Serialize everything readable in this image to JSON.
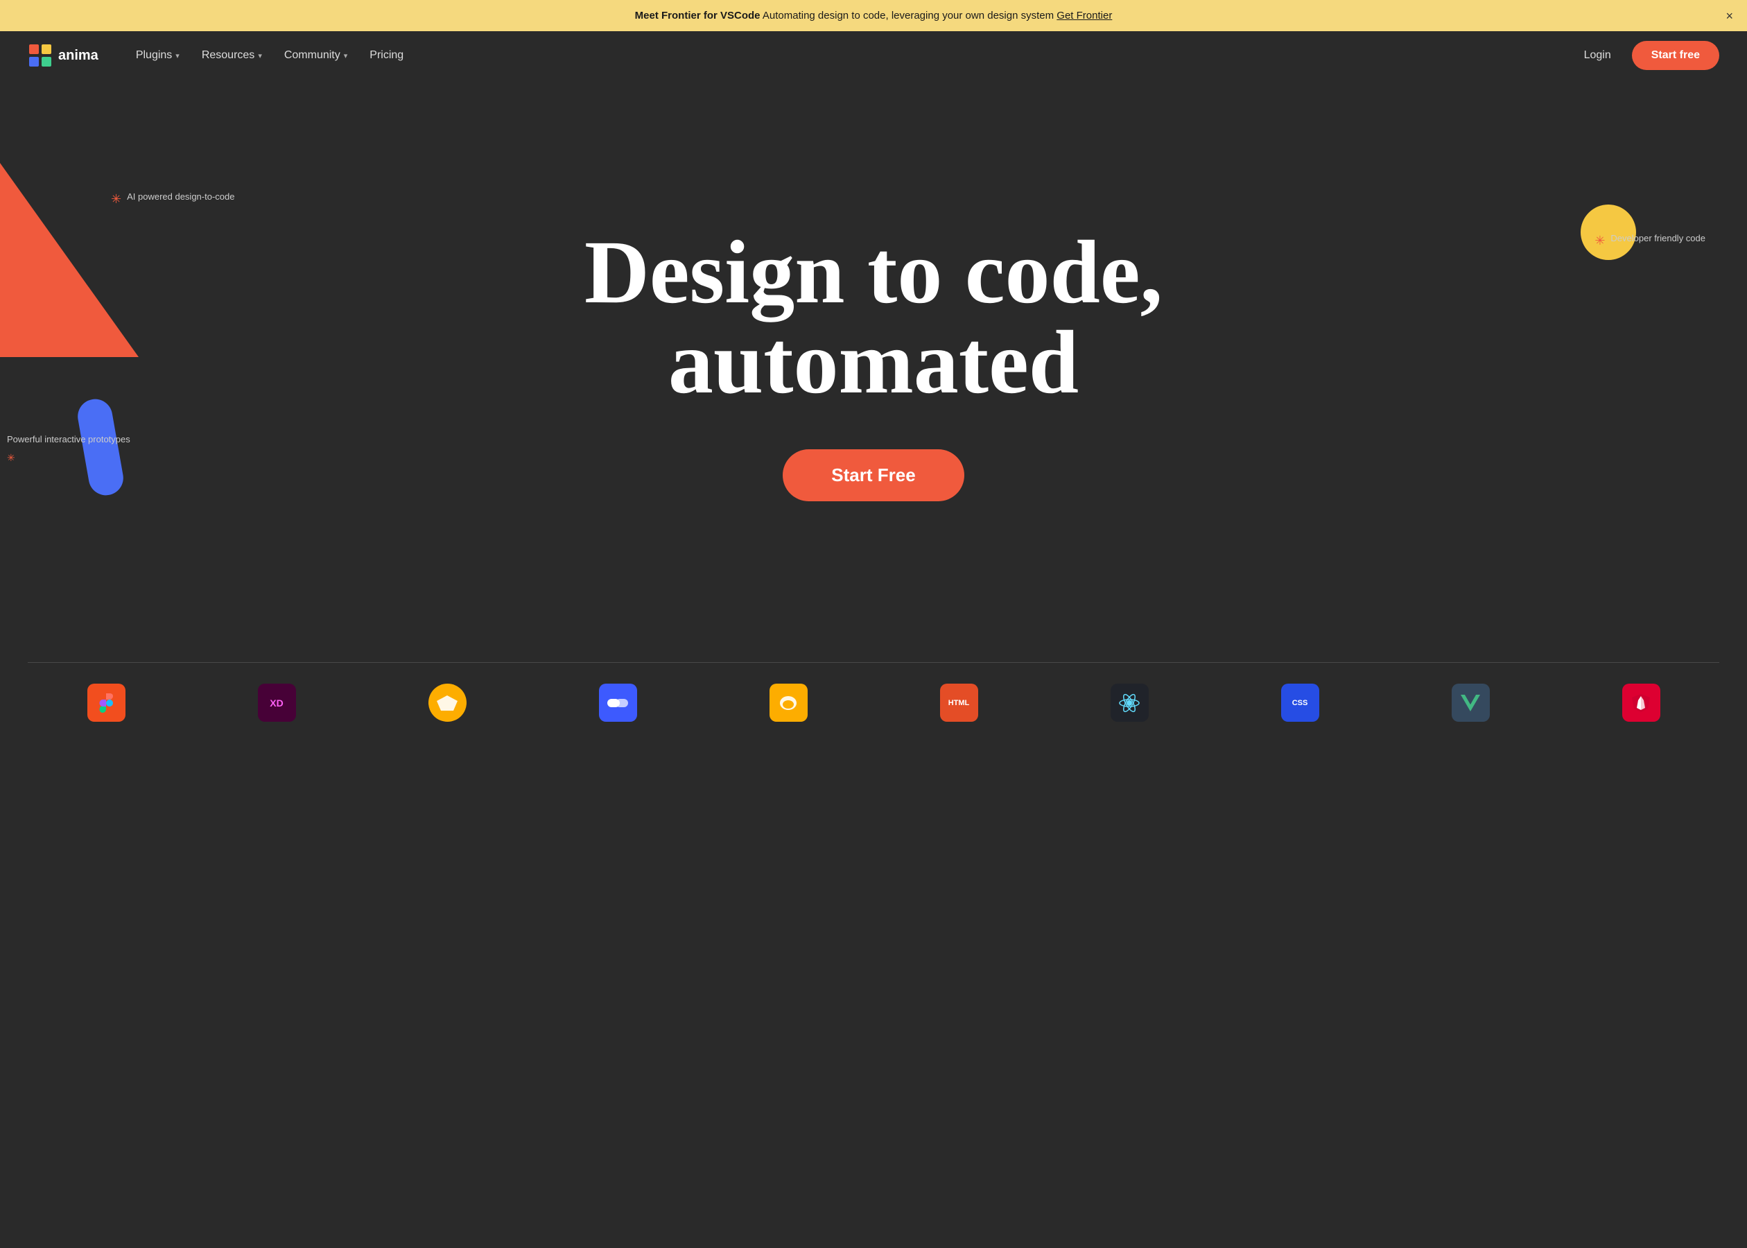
{
  "announcement": {
    "text_bold": "Meet Frontier for VSCode",
    "text_normal": " Automating design to code, leveraging your own design system",
    "link_text": "Get Frontier",
    "close_label": "×"
  },
  "nav": {
    "logo_text": "anima",
    "plugins_label": "Plugins",
    "resources_label": "Resources",
    "community_label": "Community",
    "pricing_label": "Pricing",
    "login_label": "Login",
    "start_free_label": "Start free"
  },
  "hero": {
    "ai_label": "AI powered design-to-code",
    "developer_label": "Developer friendly code",
    "prototypes_label": "Powerful interactive prototypes",
    "title_line1": "Design to code,",
    "title_line2": "automated",
    "cta_label": "Start Free"
  },
  "logos": {
    "items": [
      {
        "label": "Figma",
        "color": "#f24e1e"
      },
      {
        "label": "XD",
        "color": "#ff61f6"
      },
      {
        "label": "Sketch",
        "color": "#fdad00"
      },
      {
        "label": "Overflow",
        "color": "#3d5afe"
      },
      {
        "label": "Zeplin",
        "color": "#fdad00"
      },
      {
        "label": "HTML",
        "color": "#e44d26"
      },
      {
        "label": "React",
        "color": "#61dafb"
      },
      {
        "label": "CSS",
        "color": "#264de4"
      },
      {
        "label": "Vue",
        "color": "#42b883"
      },
      {
        "label": "Angular",
        "color": "#dd0031"
      }
    ]
  },
  "colors": {
    "accent": "#f05a3d",
    "blue_shape": "#4a6ef5",
    "yellow": "#f5c842",
    "bg_dark": "#2a2a2a",
    "announcement_bg": "#f5d97e"
  }
}
